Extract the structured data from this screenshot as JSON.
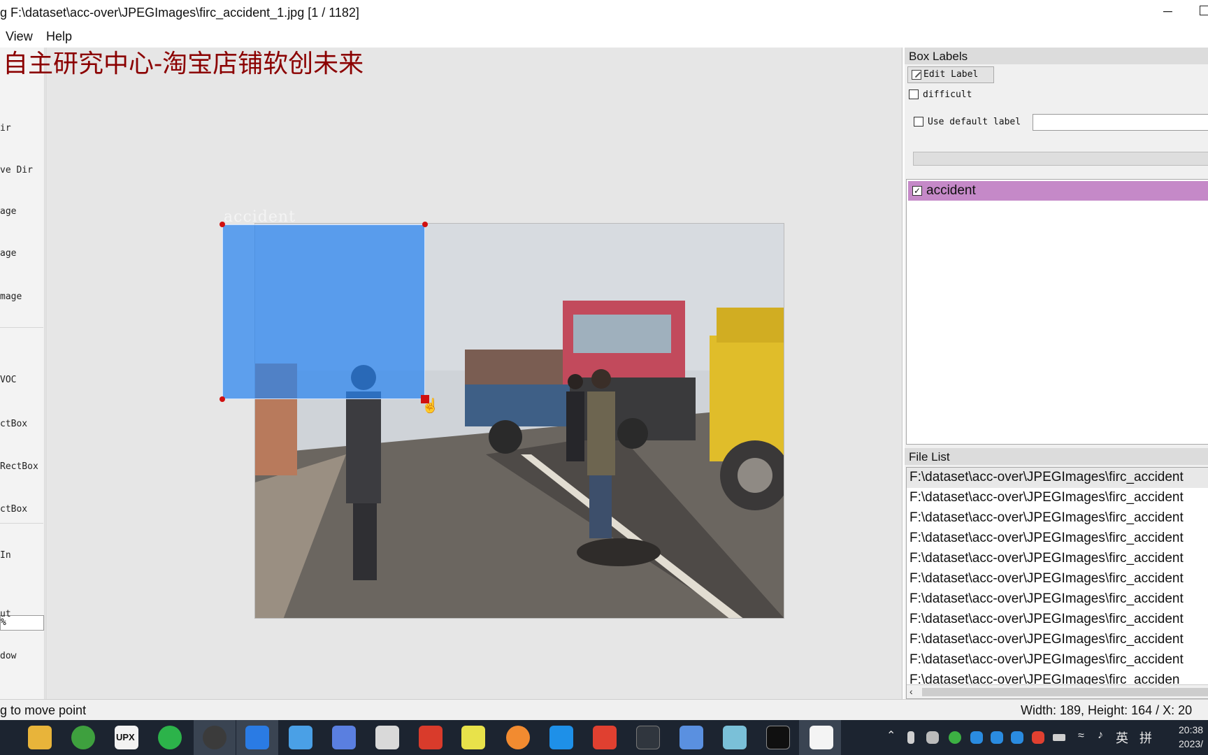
{
  "window": {
    "title": "g F:\\dataset\\acc-over\\JPEGImages\\firc_accident_1.jpg [1 / 1182]",
    "minimize_glyph": "─"
  },
  "menu": {
    "view": "View",
    "help": "Help"
  },
  "watermark": "自主研究中心-淘宝店铺软创未来",
  "toolbar": {
    "open_dir": "ir",
    "change_save_dir": "ve Dir",
    "next_image": "age",
    "prev_image": "age",
    "verify_image": "mage",
    "save_format": "VOC",
    "create_rectbox": "ctBox",
    "duplicate_rectbox": "RectBox",
    "delete_rectbox": "ctBox",
    "zoom_in": "In",
    "zoom_value": "%",
    "zoom_out": "ut",
    "fit_window": "dow"
  },
  "canvas": {
    "bbox_label": "accident",
    "cursor": "hand-pointer-icon"
  },
  "box_labels": {
    "title": "Box Labels",
    "edit_label": "Edit Label",
    "difficult": "difficult",
    "use_default_label": "Use default label",
    "default_label_value": "",
    "items": [
      {
        "label": "accident",
        "checked": true,
        "color": "#c589c8"
      }
    ]
  },
  "file_list": {
    "title": "File List",
    "items": [
      "F:\\dataset\\acc-over\\JPEGImages\\firc_accident",
      "F:\\dataset\\acc-over\\JPEGImages\\firc_accident",
      "F:\\dataset\\acc-over\\JPEGImages\\firc_accident",
      "F:\\dataset\\acc-over\\JPEGImages\\firc_accident",
      "F:\\dataset\\acc-over\\JPEGImages\\firc_accident",
      "F:\\dataset\\acc-over\\JPEGImages\\firc_accident",
      "F:\\dataset\\acc-over\\JPEGImages\\firc_accident",
      "F:\\dataset\\acc-over\\JPEGImages\\firc_accident",
      "F:\\dataset\\acc-over\\JPEGImages\\firc_accident",
      "F:\\dataset\\acc-over\\JPEGImages\\firc_accident",
      "F:\\dataset\\acc-over\\JPEGImages\\firc_acciden"
    ]
  },
  "status": {
    "left": "g to move point",
    "right": "Width: 189, Height: 164 / X: 20"
  },
  "taskbar": {
    "upx": "UPX",
    "ime_lang": "英",
    "ime_mode": "拼",
    "time": "20:38",
    "date": "2023/"
  },
  "colors": {
    "bbox_fill": "#2884f0",
    "vertex": "#d01010",
    "watermark": "#8b0000",
    "label_highlight": "#c589c8",
    "taskbar_bg": "#1c2430"
  }
}
